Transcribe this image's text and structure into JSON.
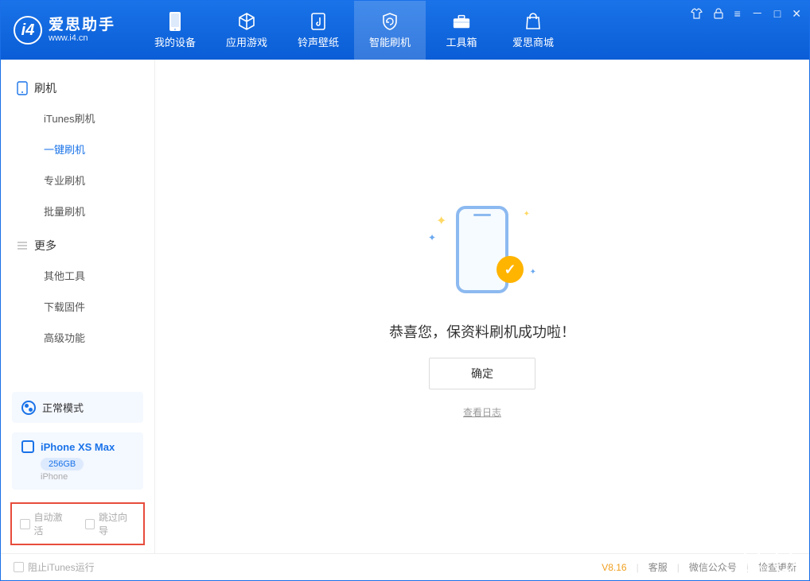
{
  "app": {
    "name": "爱思助手",
    "domain": "www.i4.cn"
  },
  "tabs": [
    {
      "label": "我的设备"
    },
    {
      "label": "应用游戏"
    },
    {
      "label": "铃声壁纸"
    },
    {
      "label": "智能刷机"
    },
    {
      "label": "工具箱"
    },
    {
      "label": "爱思商城"
    }
  ],
  "sidebar": {
    "section1": {
      "title": "刷机"
    },
    "items1": [
      {
        "label": "iTunes刷机"
      },
      {
        "label": "一键刷机"
      },
      {
        "label": "专业刷机"
      },
      {
        "label": "批量刷机"
      }
    ],
    "section2": {
      "title": "更多"
    },
    "items2": [
      {
        "label": "其他工具"
      },
      {
        "label": "下载固件"
      },
      {
        "label": "高级功能"
      }
    ]
  },
  "mode": {
    "label": "正常模式"
  },
  "device": {
    "name": "iPhone XS Max",
    "storage": "256GB",
    "type": "iPhone"
  },
  "options": {
    "auto_activate": "自动激活",
    "skip_guide": "跳过向导"
  },
  "main": {
    "success": "恭喜您，保资料刷机成功啦！",
    "ok": "确定",
    "view_log": "查看日志"
  },
  "status": {
    "block_itunes": "阻止iTunes运行",
    "version": "V8.16",
    "support": "客服",
    "wechat": "微信公众号",
    "update": "检查更新"
  }
}
